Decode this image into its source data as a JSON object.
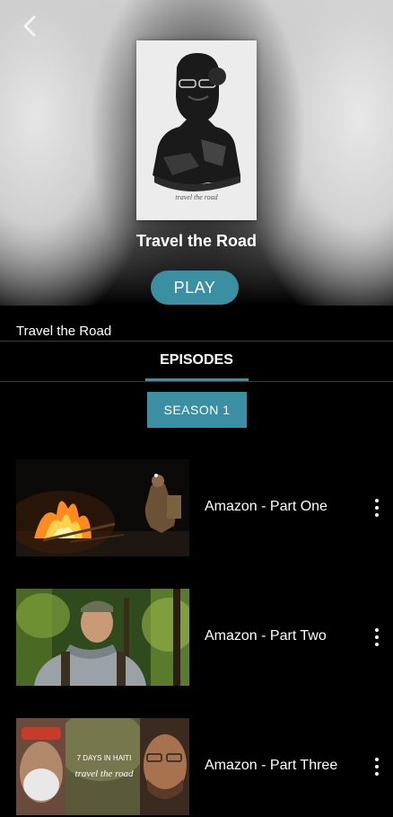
{
  "header": {
    "back_icon": "back-arrow-icon"
  },
  "hero": {
    "poster_logo_text": "travel the road",
    "title": "Travel the Road",
    "play_label": "PLAY"
  },
  "show": {
    "name": "Travel the Road"
  },
  "tabs": {
    "episodes_label": "EPISODES"
  },
  "season": {
    "label": "SEASON 1"
  },
  "episodes": [
    {
      "title": "Amazon - Part One"
    },
    {
      "title": "Amazon - Part Two"
    },
    {
      "title": "Amazon - Part Three",
      "thumb_caption": "7 DAYS IN HAITI",
      "thumb_logo": "travel the road"
    }
  ],
  "colors": {
    "accent": "#3a8fa3",
    "background": "#000000"
  }
}
